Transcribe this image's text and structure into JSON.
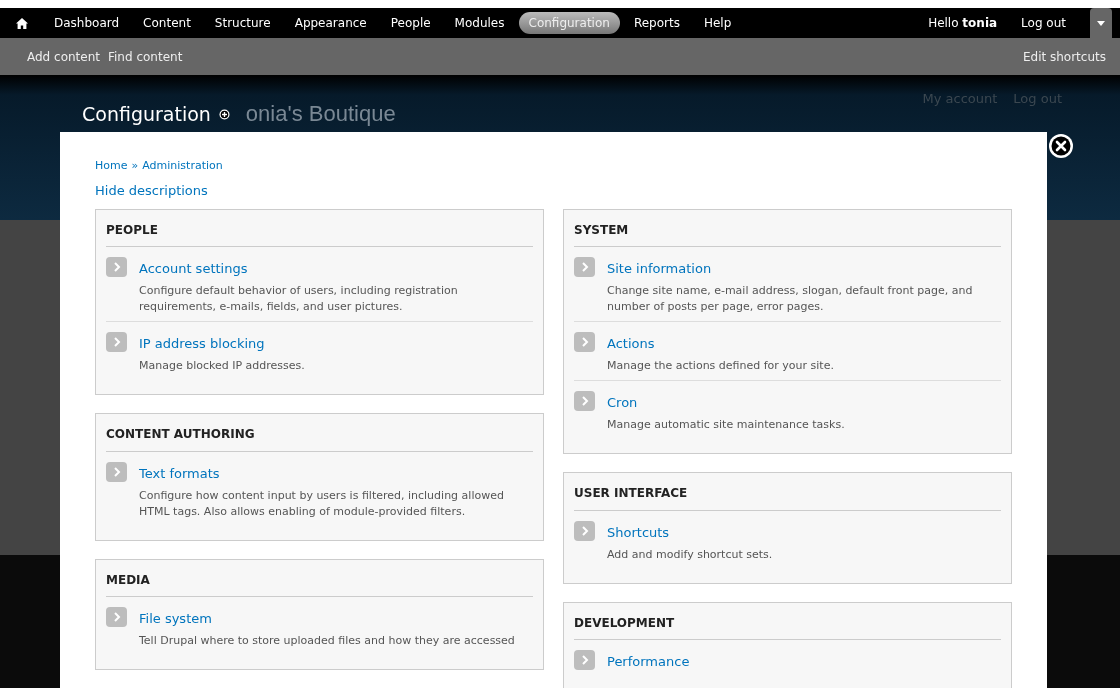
{
  "toolbar": {
    "menu": [
      {
        "label": "Dashboard",
        "selected": false
      },
      {
        "label": "Content",
        "selected": false
      },
      {
        "label": "Structure",
        "selected": false
      },
      {
        "label": "Appearance",
        "selected": false
      },
      {
        "label": "People",
        "selected": false
      },
      {
        "label": "Modules",
        "selected": false
      },
      {
        "label": "Configuration",
        "selected": true
      },
      {
        "label": "Reports",
        "selected": false
      },
      {
        "label": "Help",
        "selected": false
      }
    ],
    "greeting": "Hello **tonia**",
    "logout": "Log out"
  },
  "shortcuts": {
    "items": [
      "Add content",
      "Find content"
    ],
    "edit": "Edit shortcuts"
  },
  "header": {
    "page_title": "Configuration",
    "site_name": "onia's Boutique",
    "secondary_links": [
      "My account",
      "Log out"
    ]
  },
  "overlay": {
    "breadcrumb": [
      "Home",
      "Administration"
    ],
    "separator": "»",
    "toggle": "Hide descriptions",
    "columns": [
      [
        {
          "title": "PEOPLE",
          "items": [
            {
              "title": "Account settings",
              "description": "Configure default behavior of users, including registration requirements, e-mails, fields, and user pictures."
            },
            {
              "title": "IP address blocking",
              "description": "Manage blocked IP addresses."
            }
          ]
        },
        {
          "title": "CONTENT AUTHORING",
          "items": [
            {
              "title": "Text formats",
              "description": "Configure how content input by users is filtered, including allowed HTML tags. Also allows enabling of module-provided filters."
            }
          ]
        },
        {
          "title": "MEDIA",
          "items": [
            {
              "title": "File system",
              "description": "Tell Drupal where to store uploaded files and how they are accessed"
            }
          ]
        }
      ],
      [
        {
          "title": "SYSTEM",
          "items": [
            {
              "title": "Site information",
              "description": "Change site name, e-mail address, slogan, default front page, and number of posts per page, error pages."
            },
            {
              "title": "Actions",
              "description": "Manage the actions defined for your site."
            },
            {
              "title": "Cron",
              "description": "Manage automatic site maintenance tasks."
            }
          ]
        },
        {
          "title": "USER INTERFACE",
          "items": [
            {
              "title": "Shortcuts",
              "description": "Add and modify shortcut sets."
            }
          ]
        },
        {
          "title": "DEVELOPMENT",
          "items": [
            {
              "title": "Performance"
            }
          ]
        }
      ]
    ]
  }
}
